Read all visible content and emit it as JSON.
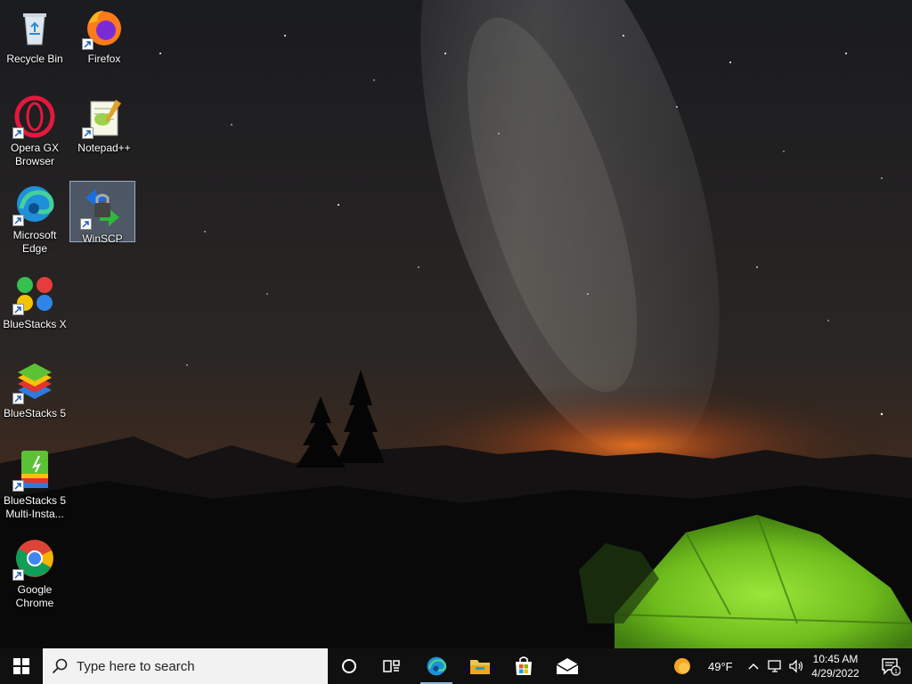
{
  "desktop": {
    "icons": [
      {
        "label": "Recycle Bin",
        "icon": "recycle-bin-icon"
      },
      {
        "label": "Firefox",
        "icon": "firefox-icon"
      },
      {
        "label": "Opera GX Browser",
        "icon": "opera-gx-icon"
      },
      {
        "label": "Notepad++",
        "icon": "notepad-plus-plus-icon"
      },
      {
        "label": "Microsoft Edge",
        "icon": "edge-icon"
      },
      {
        "label": "WinSCP",
        "icon": "winscp-icon",
        "selected": true
      },
      {
        "label": "BlueStacks X",
        "icon": "bluestacks-x-icon"
      },
      {
        "label": "BlueStacks 5",
        "icon": "bluestacks-5-icon"
      },
      {
        "label": "BlueStacks 5 Multi-Insta...",
        "icon": "bluestacks-multi-instance-icon"
      },
      {
        "label": "Google Chrome",
        "icon": "chrome-icon"
      }
    ]
  },
  "taskbar": {
    "search_placeholder": "Type here to search",
    "pinned": [
      "cortana-icon",
      "task-view-icon",
      "edge-icon",
      "file-explorer-icon",
      "microsoft-store-icon",
      "mail-icon"
    ],
    "weather": {
      "temp": "49°F",
      "icon": "weather-sun-icon"
    },
    "clock": {
      "time": "10:45 AM",
      "date": "4/29/2022"
    },
    "notifications_count": "1"
  },
  "colors": {
    "taskbar_bg": "#101010",
    "search_bg": "#f2f2f2",
    "tent_green": "#7ed321",
    "horizon_glow": "#e2661b"
  }
}
